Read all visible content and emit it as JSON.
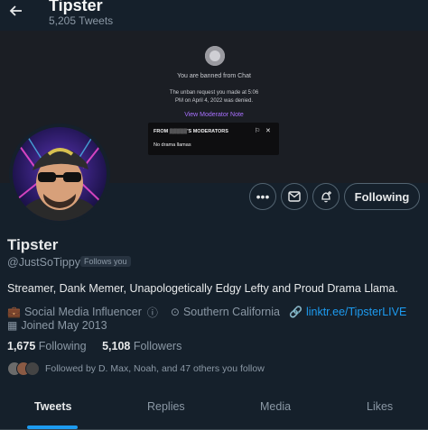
{
  "header": {
    "title": "Tipster",
    "subtitle": "5,205 Tweets"
  },
  "banner": {
    "banned_text": "You are banned from Chat",
    "unban_line1": "The unban request you made at 5:06",
    "unban_line2": "PM on April 4, 2022 was denied.",
    "moderator_link": "View Moderator Note",
    "mod_from": "FROM ▒▒▒▒▒'S MODERATORS",
    "mod_note": "No drama llamas"
  },
  "actions": {
    "follow_label": "Following"
  },
  "profile": {
    "name": "Tipster",
    "handle": "@JustSoTippy",
    "follows_you": "Follows you",
    "bio": "Streamer, Dank Memer, Unapologetically Edgy Lefty and Proud Drama Llama.",
    "category": "Social Media Influencer",
    "location": "Southern California",
    "link": "linktr.ee/TipsterLIVE",
    "joined": "Joined May 2013"
  },
  "counts": {
    "following_num": "1,675",
    "following_label": "Following",
    "followers_num": "5,108",
    "followers_label": "Followers"
  },
  "followed_by": "Followed by D. Max, Noah, and 47 others you follow",
  "tabs": [
    {
      "label": "Tweets"
    },
    {
      "label": "Replies"
    },
    {
      "label": "Media"
    },
    {
      "label": "Likes"
    }
  ],
  "colors": {
    "background": "#15202b",
    "accent": "#1d9bf0",
    "twitch_purple": "#a970ff"
  }
}
